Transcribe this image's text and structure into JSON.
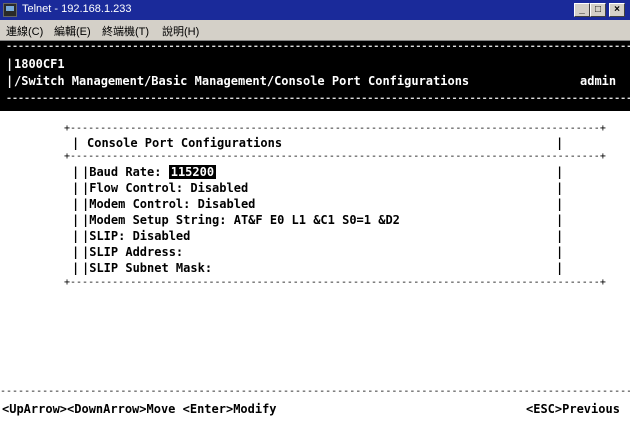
{
  "window": {
    "title": "Telnet - 192.168.1.233",
    "menu": [
      "連線(C)",
      "編輯(E)",
      "終端機(T)",
      "說明(H)"
    ]
  },
  "header": {
    "hostname": "1800CF1",
    "path": "/Switch Management/Basic Management/Console Port Configurations",
    "user": "admin"
  },
  "panel": {
    "title": "Console Port Configurations",
    "fields": [
      {
        "label": "Baud Rate: ",
        "value": "115200"
      },
      {
        "label": "Flow Control: Disabled"
      },
      {
        "label": "Modem Control: Disabled"
      },
      {
        "label": "Modem Setup String: AT&F E0 L1 &C1 S0=1 &D2"
      },
      {
        "label": "SLIP: Disabled"
      },
      {
        "label": "SLIP Address:"
      },
      {
        "label": "SLIP Subnet Mask:"
      }
    ]
  },
  "footer": {
    "left": "<UpArrow><DownArrow>Move   <Enter>Modify",
    "right": "<ESC>Previous"
  }
}
